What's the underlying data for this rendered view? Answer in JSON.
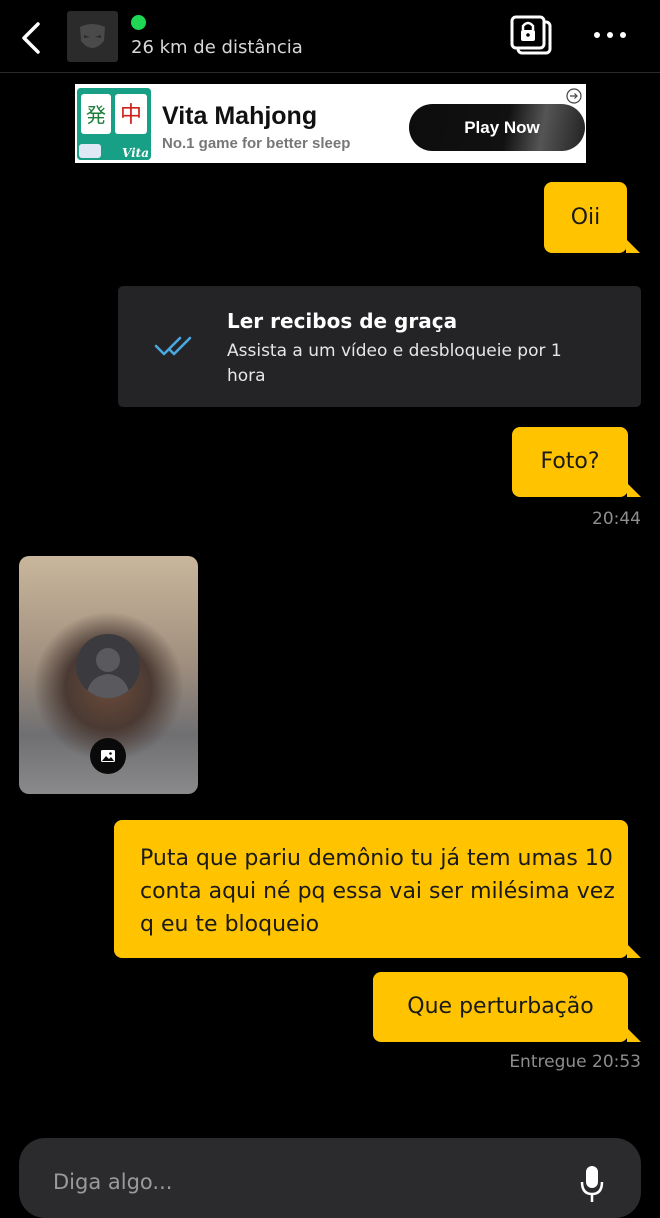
{
  "header": {
    "distance": "26 km de distância",
    "online_color": "#1fd655",
    "icons": [
      "back-arrow-icon",
      "avatar-placeholder",
      "album-lock-icon",
      "more-dots-icon"
    ]
  },
  "ad": {
    "title": "Vita Mahjong",
    "subtitle": "No.1 game for better sleep",
    "cta": "Play Now",
    "logo_text": "Vita"
  },
  "messages": {
    "m1": "Oii",
    "receipt_title": "Ler recibos de graça",
    "receipt_desc": "Assista a um vídeo e desbloqueie por 1 hora",
    "m2": "Foto?",
    "m2_time": "20:44",
    "m3": "Puta que pariu demônio tu já tem umas 10 conta aqui né pq essa vai ser milésima vez q eu te bloqueio",
    "m4": "Que perturbação",
    "m4_status": "Entregue 20:53"
  },
  "composer": {
    "placeholder": "Diga algo..."
  },
  "colors": {
    "bubble": "#ffc300",
    "background": "#000000",
    "receipt_check": "#4aa8e0"
  }
}
